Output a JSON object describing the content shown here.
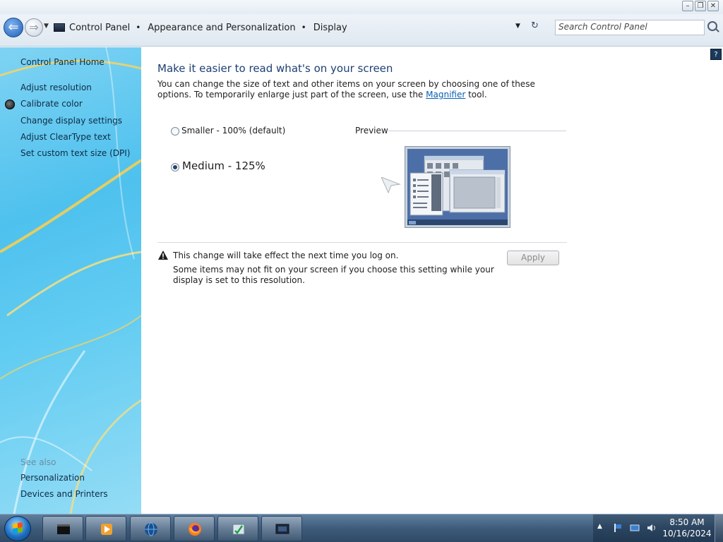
{
  "window": {
    "caption_buttons": [
      "minimize",
      "restore",
      "close"
    ]
  },
  "navbar": {
    "breadcrumbs": [
      "Control Panel",
      "Appearance and Personalization",
      "Display"
    ],
    "separator": "•",
    "search_placeholder": "Search Control Panel"
  },
  "sidebar": {
    "home": "Control Panel Home",
    "links": [
      "Adjust resolution",
      "Calibrate color",
      "Change display settings",
      "Adjust ClearType text",
      "Set custom text size (DPI)"
    ],
    "see_also_title": "See also",
    "see_also_links": [
      "Personalization",
      "Devices and Printers"
    ]
  },
  "main": {
    "heading": "Make it easier to read what's on your screen",
    "intro_before": "You can change the size of text and other items on your screen by choosing one of these options. To temporarily enlarge just part of the screen, use the ",
    "intro_link": "Magnifier",
    "intro_after": " tool.",
    "options": [
      {
        "label": "Smaller - 100% (default)",
        "selected": false
      },
      {
        "label": "Medium - 125%",
        "selected": true
      }
    ],
    "preview_label": "Preview",
    "warning_title": "This change will take effect the next time you log on.",
    "warning_detail": "Some items may not fit on your screen if you choose this setting while your display is set to this resolution.",
    "apply_label": "Apply",
    "apply_enabled": false
  },
  "taskbar": {
    "pinned": [
      "command-prompt",
      "media-player",
      "globe-app",
      "firefox",
      "task-app",
      "display-app"
    ],
    "clock_time": "8:50 AM",
    "clock_date": "10/16/2024"
  },
  "colors": {
    "heading": "#1d3f73",
    "link": "#0a5fb3",
    "sidebar_text": "#0d2b45",
    "taskbar": "#3e5b7a"
  }
}
